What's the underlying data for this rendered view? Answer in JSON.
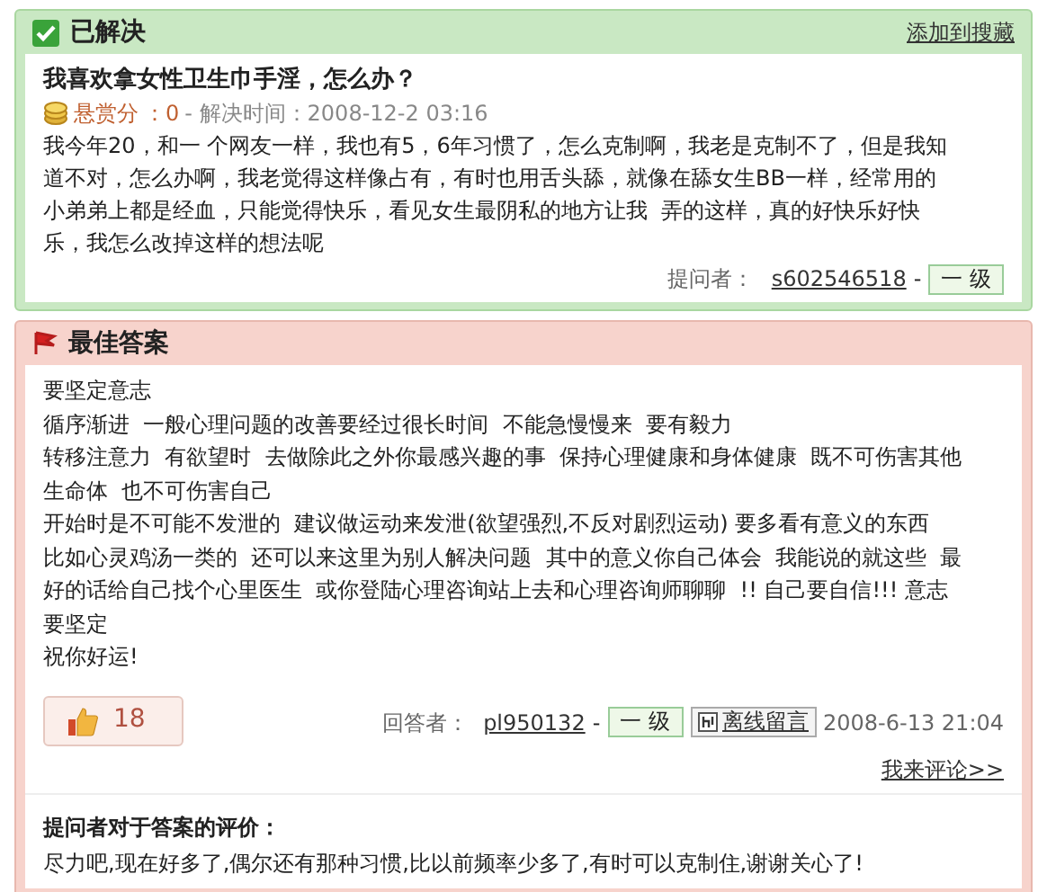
{
  "question_panel": {
    "status": "已解决",
    "add_link": "添加到搜藏",
    "title": "我喜欢拿女性卫生巾手淫，怎么办？",
    "meta": {
      "reward_label": "悬赏分",
      "reward": "：0",
      "solved_label": "- 解决时间：2008-12-2 03:16"
    },
    "body_lines": [
      "我今年20，和一 个网友一样，我也有5，6年习惯了，怎么克制啊，我老是克制不了，但是我知",
      "道不对，怎么办啊，我老觉得这样像占有，有时也用舌头舔，就像在舔女生BB一样，经常用的",
      "小弟弟上都是经血，只能觉得快乐，看见女生最阴私的地方让我  弄的这样，真的好快乐好快",
      "乐，我怎么改掉这样的想法呢"
    ],
    "asker_label": "提问者：",
    "asker": "s602546518",
    "separator": "-",
    "level": "一 级"
  },
  "answer_panel": {
    "title": "最佳答案",
    "body_lines": [
      "要坚定意志",
      "循序渐进  一般心理问题的改善要经过很长时间  不能急慢慢来  要有毅力",
      "转移注意力  有欲望时  去做除此之外你最感兴趣的事  保持心理健康和身体健康  既不可伤害其他",
      "生命体  也不可伤害自己",
      "开始时是不可能不发泄的  建议做运动来发泄(欲望强烈,不反对剧烈运动) 要多看有意义的东西",
      "比如心灵鸡汤一类的  还可以来这里为别人解决问题  其中的意义你自己体会  我能说的就这些  最",
      "好的话给自己找个心里医生  或你登陆心理咨询站上去和心理咨询师聊聊  !! 自己要自信!!! 意志",
      "要坚定",
      "祝你好运!"
    ],
    "likes": "18",
    "answerer_label": "回答者：",
    "answerer": "pl950132",
    "separator": "-",
    "level": "一 级",
    "message_link": "离线留言",
    "date": "2008-6-13 21:04",
    "comment_link": "我来评论>>",
    "evaluation_title": "提问者对于答案的评价：",
    "evaluation": "尽力吧,现在好多了,偶尔还有那种习惯,比以前频率少多了,有时可以克制住,谢谢关心了!"
  }
}
